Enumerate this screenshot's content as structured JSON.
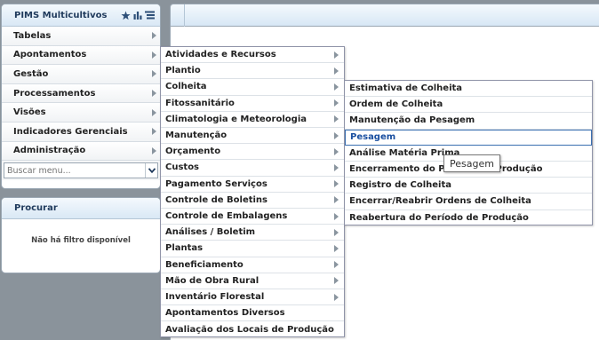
{
  "sidebar": {
    "title": "PIMS Multicultivos",
    "items": [
      {
        "label": "Tabelas"
      },
      {
        "label": "Apontamentos"
      },
      {
        "label": "Gestão"
      },
      {
        "label": "Processamentos"
      },
      {
        "label": "Visões"
      },
      {
        "label": "Indicadores Gerenciais"
      },
      {
        "label": "Administração"
      }
    ],
    "search_placeholder": "Buscar menu...",
    "icons": [
      "star-icon",
      "bar-chart-icon",
      "list-icon"
    ]
  },
  "procurar": {
    "title": "Procurar",
    "empty_text": "Não há filtro disponível"
  },
  "menu_apontamentos": {
    "items": [
      {
        "label": "Atividades e Recursos"
      },
      {
        "label": "Plantio"
      },
      {
        "label": "Colheita"
      },
      {
        "label": "Fitossanitário"
      },
      {
        "label": "Climatologia e Meteorologia"
      },
      {
        "label": "Manutenção"
      },
      {
        "label": "Orçamento"
      },
      {
        "label": "Custos"
      },
      {
        "label": "Pagamento Serviços"
      },
      {
        "label": "Controle de Boletins"
      },
      {
        "label": "Controle de Embalagens"
      },
      {
        "label": "Análises / Boletim"
      },
      {
        "label": "Plantas"
      },
      {
        "label": "Beneficiamento"
      },
      {
        "label": "Mão de Obra Rural"
      },
      {
        "label": "Inventário Florestal"
      },
      {
        "label": "Apontamentos Diversos"
      },
      {
        "label": "Avaliação dos Locais de Produção"
      }
    ]
  },
  "menu_colheita": {
    "items": [
      {
        "label": "Estimativa de Colheita"
      },
      {
        "label": "Ordem de Colheita"
      },
      {
        "label": "Manutenção da Pesagem"
      },
      {
        "label": "Pesagem"
      },
      {
        "label": "Análise Matéria Prima"
      },
      {
        "label": "Encerramento do Período de Produção"
      },
      {
        "label": "Registro de Colheita"
      },
      {
        "label": "Encerrar/Reabrir Ordens de Colheita"
      },
      {
        "label": "Reabertura do Período de Produção"
      }
    ],
    "selected": "Pesagem"
  },
  "tooltip": {
    "text": "Pesagem"
  },
  "colors": {
    "accent": "#1f3a5c",
    "selection_border": "#3a6fb0",
    "background": "#8a939b"
  }
}
